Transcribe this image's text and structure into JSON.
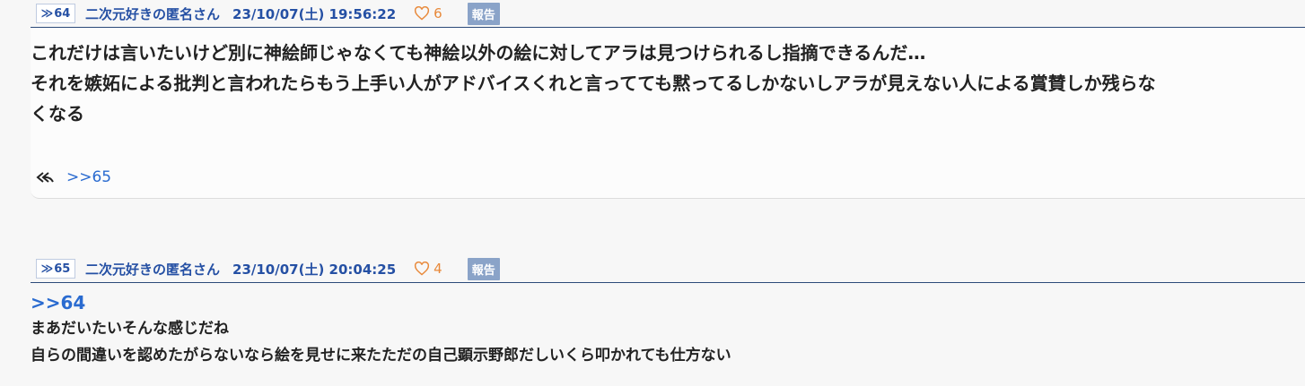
{
  "posts": [
    {
      "resnum": "64",
      "resnum_arrow": "≫",
      "name": "二次元好きの匿名さん",
      "date": "23/10/07(土) 19:56:22",
      "likes": "6",
      "report": "報告",
      "lines": [
        "これだけは言いたいけど別に神絵師じゃなくても神絵以外の絵に対してアラは見つけられるし指摘できるんだ…",
        "それを嫉妬による批判と言われたらもう上手い人がアドバイスくれと言ってても黙ってるしかないしアラが見えない人による賞賛しか残らな",
        "くなる"
      ],
      "replies": [
        ">>65"
      ]
    },
    {
      "resnum": "65",
      "resnum_arrow": "≫",
      "name": "二次元好きの匿名さん",
      "date": "23/10/07(土) 20:04:25",
      "likes": "4",
      "report": "報告",
      "anchor": ">>64",
      "lines": [
        "まあだいたいそんな感じだね",
        "自らの間違いを認めたがらないなら絵を見せに来たただの自己顕示野郎だしいくら叩かれても仕方ない"
      ]
    }
  ],
  "colors": {
    "accent": "#2550a4",
    "like": "#e8893a",
    "report_bg": "#8aa3c8",
    "link": "#2a6bd0"
  }
}
